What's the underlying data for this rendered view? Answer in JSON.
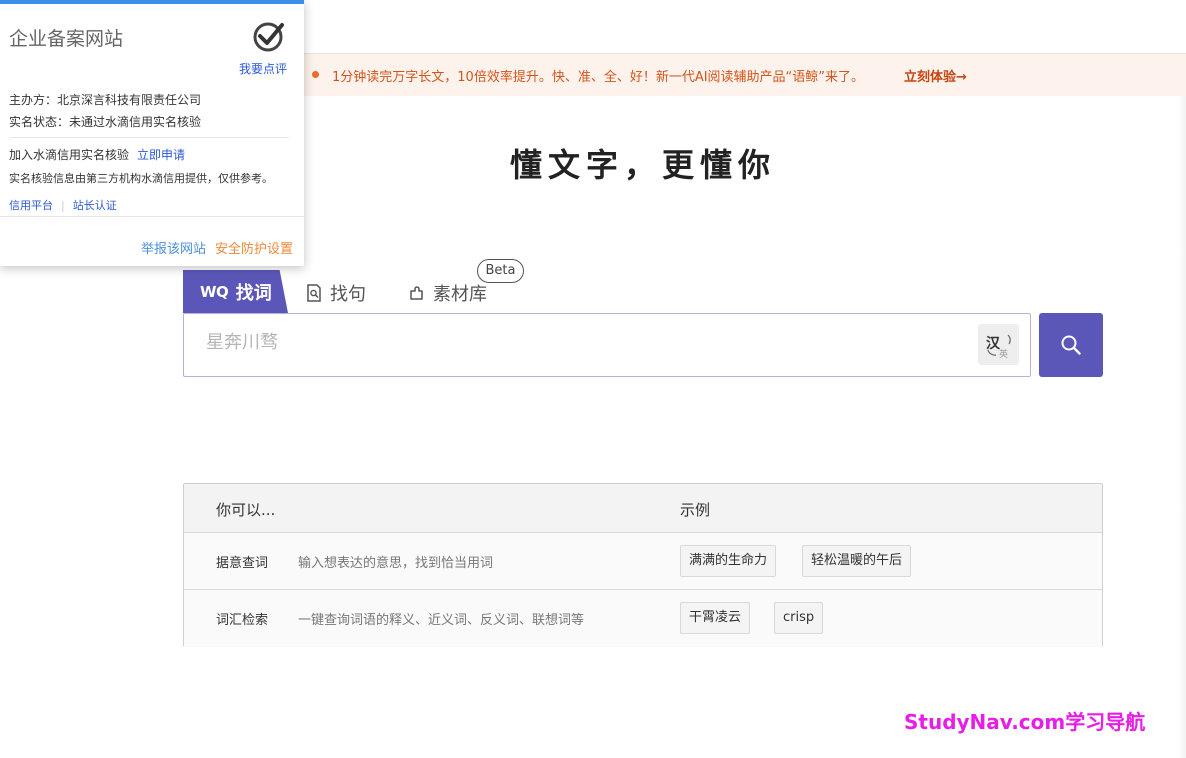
{
  "popup": {
    "title": "企业备案网站",
    "review_link": "我要点评",
    "sponsor": "主办方：北京深言科技有限责任公司",
    "verify_status": "实名状态：未通过水滴信用实名核验",
    "join_text": "加入水滴信用实名核验",
    "apply_link": "立即申请",
    "note": "实名核验信息由第三方机构水滴信用提供，仅供参考。",
    "credit_link": "信用平台",
    "owner_link": "站长认证",
    "report_link": "举报该网站",
    "security_link": "安全防护设置",
    "colors": {
      "accent": "#3d8ee8",
      "link": "#2c5ad6",
      "security": "#ef8a3a"
    }
  },
  "banner": {
    "text": "1分钟读完万字长文，10倍效率提升。快、准、全、好！新一代AI阅读辅助产品“语鲸”来了。",
    "link": "立刻体验→",
    "colors": {
      "background": "#fdf3ec",
      "text": "#d4541a"
    }
  },
  "headline": "懂文字，更懂你",
  "tabs": [
    {
      "label": "找词",
      "icon": "wantwords-logo-icon",
      "active": true
    },
    {
      "label": "找句",
      "icon": "document-search-icon",
      "active": false
    },
    {
      "label": "素材库",
      "icon": "puzzle-icon",
      "active": false,
      "badge": "Beta"
    }
  ],
  "search": {
    "placeholder": "星奔川骛",
    "lang_toggle": {
      "primary": "汉",
      "secondary": "英",
      "icon": "language-switch-icon"
    },
    "button_icon": "search-icon",
    "accent": "#5b57b8"
  },
  "info_table": {
    "header_left": "你可以...",
    "header_right": "示例",
    "rows": [
      {
        "name": "据意查词",
        "desc": "输入想表达的意思，找到恰当用词",
        "examples": [
          "满满的生命力",
          "轻松温暖的午后"
        ]
      },
      {
        "name": "词汇检索",
        "desc": "一键查询词语的释义、近义词、反义词、联想词等",
        "examples": [
          "干霄凌云",
          "crisp"
        ]
      }
    ]
  },
  "watermark": "StudyNav.com学习导航"
}
